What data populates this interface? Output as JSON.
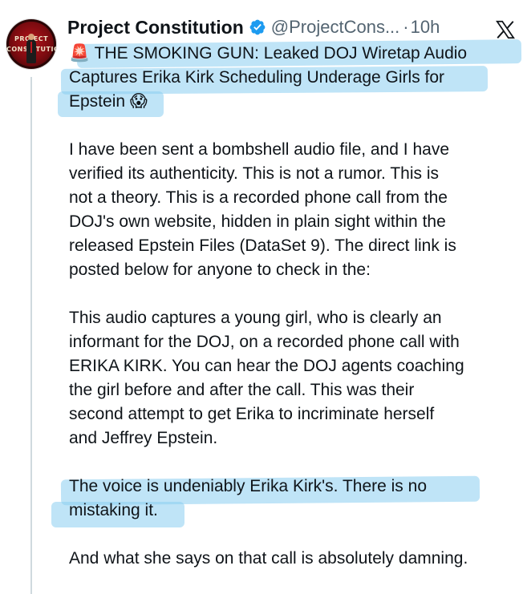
{
  "post": {
    "author": {
      "name": "Project Constitution",
      "handle": "@ProjectCons...",
      "dot": "·",
      "time": "10h",
      "avatar_text_top": "PROJECT",
      "avatar_text_bottom": "CONSTITUTION"
    },
    "platform_icon": "x-logo-icon",
    "headline": {
      "siren": "🚨",
      "lines": [
        "THE SMOKING GUN: Leaked DOJ Wiretap Audio",
        "Captures Erika Kirk Scheduling Underage Girls for",
        "Epstein"
      ],
      "emoji": "😱"
    },
    "paragraphs": [
      {
        "lines": [
          "I have been sent a bombshell audio file, and I have",
          "verified its authenticity. This is not a rumor. This is",
          "not a theory. This is a recorded phone call from the",
          "DOJ's own website, hidden in plain sight within the",
          "released Epstein Files (DataSet 9). The direct link is",
          "posted below for anyone to check in the:"
        ]
      },
      {
        "lines": [
          "This audio captures a young girl, who is clearly an",
          "informant for the DOJ, on a recorded phone call with",
          "ERIKA KIRK. You can hear the DOJ agents coaching",
          "the girl before and after the call. This was their",
          "second attempt to get Erika to incriminate herself",
          "and Jeffrey Epstein."
        ]
      },
      {
        "lines": [
          "The voice is undeniably Erika Kirk's. There is no",
          "mistaking it."
        ]
      },
      {
        "lines": [
          "And what she says on that call is absolutely damning."
        ]
      }
    ]
  },
  "colors": {
    "text": "#0f1419",
    "secondary": "#536471",
    "verified": "#1d9bf0",
    "highlight": "#8acef0"
  }
}
